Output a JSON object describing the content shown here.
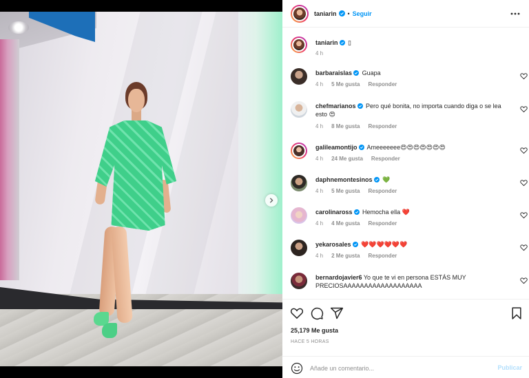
{
  "post": {
    "author": "taniarin",
    "follow_label": "Seguir",
    "separator": "•",
    "caption_emoji": "▯",
    "caption_time": "4 h",
    "likes_text": "25,179 Me gusta",
    "time_ago": "HACE 5 HORAS",
    "reply_label": "Responder"
  },
  "comments": [
    {
      "user": "barbaraislas",
      "text": "Guapa",
      "time": "4 h",
      "likes": "5 Me gusta"
    },
    {
      "user": "chefmarianos",
      "text": "Pero qué bonita, no importa cuando diga o se lea esto 😍",
      "time": "4 h",
      "likes": "8 Me gusta"
    },
    {
      "user": "galileamontijo",
      "text": "Ameeeeeee😍😍😍😍😍😍😍",
      "time": "4 h",
      "likes": "24 Me gusta"
    },
    {
      "user": "daphnemontesinos",
      "text": "💚",
      "time": "4 h",
      "likes": "5 Me gusta"
    },
    {
      "user": "carolinaross",
      "text": "Hemocha ella ❤️",
      "time": "4 h",
      "likes": "4 Me gusta"
    },
    {
      "user": "yekarosales",
      "text": "❤️❤️❤️❤️❤️❤️",
      "time": "4 h",
      "likes": "2 Me gusta"
    },
    {
      "user": "bernardojavier6",
      "text": "Yo que te vi en persona ESTÁS MUY PRECIOSAAAAAAAAAAAAAAAAAAA",
      "time": "",
      "likes": ""
    }
  ],
  "add_comment": {
    "placeholder": "Añade un comentario...",
    "publish_label": "Publicar"
  },
  "icons": {
    "verified": "verified-badge-icon",
    "more": "more-options-icon",
    "like": "heart-icon",
    "comment": "comment-icon",
    "share": "share-icon",
    "save": "bookmark-icon",
    "emoji": "emoji-icon",
    "next": "chevron-right-icon"
  },
  "colors": {
    "accent": "#0095f6",
    "publish_disabled": "#b2dffc",
    "meta_text": "#8e8e8e"
  },
  "carousel": {
    "slides": 2,
    "active": 1
  }
}
